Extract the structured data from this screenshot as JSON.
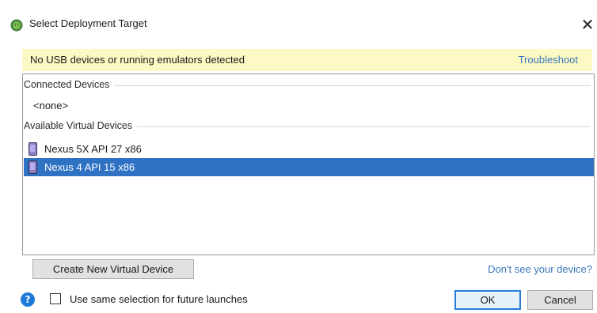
{
  "window": {
    "title": "Select Deployment Target",
    "icon": "android-studio-icon",
    "close_glyph": "✕"
  },
  "banner": {
    "message": "No USB devices or running emulators detected",
    "link": "Troubleshoot",
    "background": "#fdf9c4"
  },
  "device_list": {
    "connected_header": "Connected Devices",
    "connected_empty": "<none>",
    "available_header": "Available Virtual Devices",
    "available_devices": [
      {
        "label": "Nexus 5X API 27 x86",
        "icon": "phone-icon",
        "selected": false
      },
      {
        "label": "Nexus 4 API 15 x86",
        "icon": "phone-icon",
        "selected": true
      }
    ],
    "selection_color": "#2f72c4"
  },
  "actions": {
    "create_label": "Create New Virtual Device",
    "dont_see_link": "Don't see your device?",
    "help_glyph": "?",
    "checkbox_label": "Use same selection for future launches",
    "checkbox_checked": false,
    "ok_label": "OK",
    "cancel_label": "Cancel"
  },
  "colors": {
    "link": "#3a78bd",
    "help_icon": "#1e7ad7"
  }
}
